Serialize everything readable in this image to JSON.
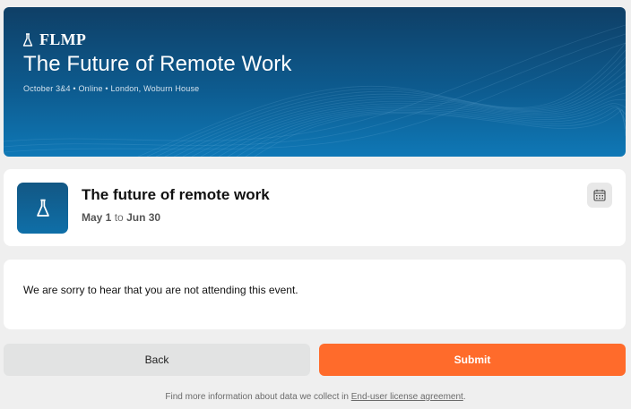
{
  "banner": {
    "brand_name": "FLMP",
    "title": "The Future of Remote Work",
    "subtitle": "October 3&4 • Online • London, Woburn House"
  },
  "event": {
    "title": "The future of remote work",
    "start_date": "May 1",
    "date_separator": "to",
    "end_date": "Jun 30",
    "calendar_icon": "calendar-icon",
    "logo_icon": "flask-icon"
  },
  "message": {
    "text": "We are sorry to hear that you are not attending this event."
  },
  "actions": {
    "back_label": "Back",
    "submit_label": "Submit"
  },
  "footer": {
    "text": "Find more information about data we collect in",
    "link_text": "End-user license agreement",
    "suffix": "."
  },
  "colors": {
    "banner": "#0d5b8f",
    "submit": "#ff6b2b",
    "back": "#e2e3e3",
    "background": "#efefef"
  }
}
